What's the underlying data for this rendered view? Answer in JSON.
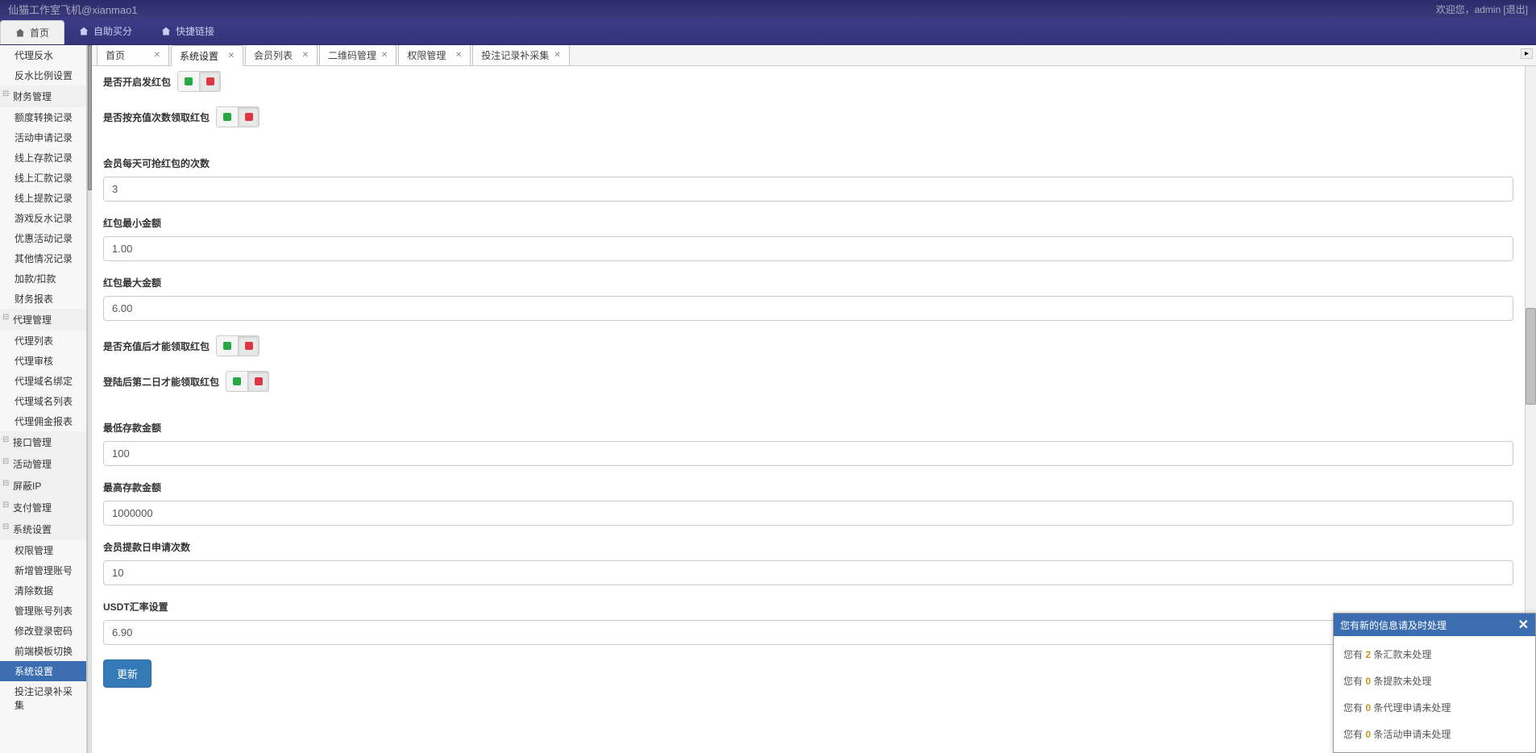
{
  "topbar": {
    "brand": "仙猫工作室飞机@xianmao1",
    "welcome_prefix": "欢迎您，",
    "username": "admin",
    "logout": "[退出]"
  },
  "menubar": {
    "home": "首页",
    "self_buy": "自助买分",
    "quick_links": "快捷链接"
  },
  "sidebar": {
    "items": [
      {
        "type": "item",
        "label": "代理反水"
      },
      {
        "type": "item",
        "label": "反水比例设置"
      },
      {
        "type": "head",
        "label": "财务管理"
      },
      {
        "type": "item",
        "label": "额度转换记录"
      },
      {
        "type": "item",
        "label": "活动申请记录"
      },
      {
        "type": "item",
        "label": "线上存款记录"
      },
      {
        "type": "item",
        "label": "线上汇款记录"
      },
      {
        "type": "item",
        "label": "线上提款记录"
      },
      {
        "type": "item",
        "label": "游戏反水记录"
      },
      {
        "type": "item",
        "label": "优惠活动记录"
      },
      {
        "type": "item",
        "label": "其他情况记录"
      },
      {
        "type": "item",
        "label": "加款/扣款"
      },
      {
        "type": "item",
        "label": "财务报表"
      },
      {
        "type": "head",
        "label": "代理管理"
      },
      {
        "type": "item",
        "label": "代理列表"
      },
      {
        "type": "item",
        "label": "代理审核"
      },
      {
        "type": "item",
        "label": "代理域名绑定"
      },
      {
        "type": "item",
        "label": "代理域名列表"
      },
      {
        "type": "item",
        "label": "代理佣金报表"
      },
      {
        "type": "head",
        "label": "接口管理"
      },
      {
        "type": "head",
        "label": "活动管理"
      },
      {
        "type": "head",
        "label": "屏蔽IP"
      },
      {
        "type": "head",
        "label": "支付管理"
      },
      {
        "type": "head",
        "label": "系统设置"
      },
      {
        "type": "item",
        "label": "权限管理"
      },
      {
        "type": "item",
        "label": "新增管理账号"
      },
      {
        "type": "item",
        "label": "清除数据"
      },
      {
        "type": "item",
        "label": "管理账号列表"
      },
      {
        "type": "item",
        "label": "修改登录密码"
      },
      {
        "type": "item",
        "label": "前端模板切换"
      },
      {
        "type": "item",
        "label": "系统设置",
        "active": true
      },
      {
        "type": "item",
        "label": "投注记录补采集"
      }
    ]
  },
  "doc_tabs": [
    {
      "label": "首页",
      "closable": true
    },
    {
      "label": "系统设置",
      "closable": true,
      "active": true
    },
    {
      "label": "会员列表",
      "closable": true
    },
    {
      "label": "二维码管理",
      "closable": true
    },
    {
      "label": "权限管理",
      "closable": true
    },
    {
      "label": "投注记录补采集",
      "closable": true
    }
  ],
  "form": {
    "toggle1_label": "是否开启发红包",
    "toggle2_label": "是否按充值次数领取红包",
    "daily_count_label": "会员每天可抢红包的次数",
    "daily_count_value": "3",
    "min_amount_label": "红包最小金额",
    "min_amount_value": "1.00",
    "max_amount_label": "红包最大金额",
    "max_amount_value": "6.00",
    "toggle3_label": "是否充值后才能领取红包",
    "toggle4_label": "登陆后第二日才能领取红包",
    "min_deposit_label": "最低存款金额",
    "min_deposit_value": "100",
    "max_deposit_label": "最高存款金额",
    "max_deposit_value": "1000000",
    "withdraw_times_label": "会员提款日申请次数",
    "withdraw_times_value": "10",
    "usdt_label": "USDT汇率设置",
    "usdt_value": "6.90",
    "submit": "更新"
  },
  "notify": {
    "title": "您有新的信息请及时处理",
    "items": [
      {
        "pre": "您有 ",
        "n": "2",
        "post": " 条汇款未处理"
      },
      {
        "pre": "您有 ",
        "n": "0",
        "post": " 条提款未处理"
      },
      {
        "pre": "您有 ",
        "n": "0",
        "post": " 条代理申请未处理"
      },
      {
        "pre": "您有 ",
        "n": "0",
        "post": " 条活动申请未处理"
      }
    ]
  }
}
